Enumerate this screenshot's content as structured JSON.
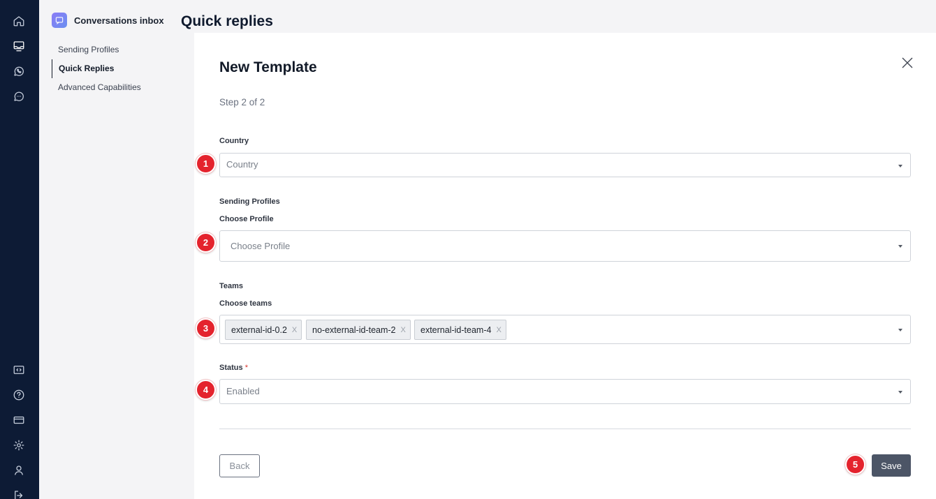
{
  "app": {
    "title": "Conversations inbox",
    "page_title": "Quick replies"
  },
  "sidebar": {
    "items": [
      {
        "label": "Sending Profiles",
        "active": false
      },
      {
        "label": "Quick Replies",
        "active": true
      },
      {
        "label": "Advanced Capabilities",
        "active": false
      }
    ]
  },
  "rail": {
    "top_icons": [
      "home-icon",
      "inbox-icon",
      "whatsapp-icon",
      "chat-bubble-icon"
    ],
    "bottom_icons": [
      "code-icon",
      "help-icon",
      "billing-card-icon",
      "settings-gear-icon",
      "user-icon",
      "logout-icon"
    ]
  },
  "form": {
    "title": "New Template",
    "step": "Step 2 of 2",
    "country": {
      "label": "Country",
      "placeholder": "Country"
    },
    "sending_profiles": {
      "section": "Sending Profiles",
      "label": "Choose Profile",
      "placeholder": "Choose Profile"
    },
    "teams": {
      "section": "Teams",
      "label": "Choose teams",
      "chips": [
        {
          "label": "external-id-0.2",
          "remove": "X"
        },
        {
          "label": "no-external-id-team-2",
          "remove": "X"
        },
        {
          "label": "external-id-team-4",
          "remove": "X"
        }
      ]
    },
    "status": {
      "label": "Status",
      "required_mark": "*",
      "value": "Enabled"
    },
    "back_label": "Back",
    "save_label": "Save"
  },
  "annotations": [
    "1",
    "2",
    "3",
    "4",
    "5"
  ],
  "colors": {
    "rail_bg": "#0d1b35",
    "primary_button": "#4c5566",
    "badge": "#e4232d"
  }
}
